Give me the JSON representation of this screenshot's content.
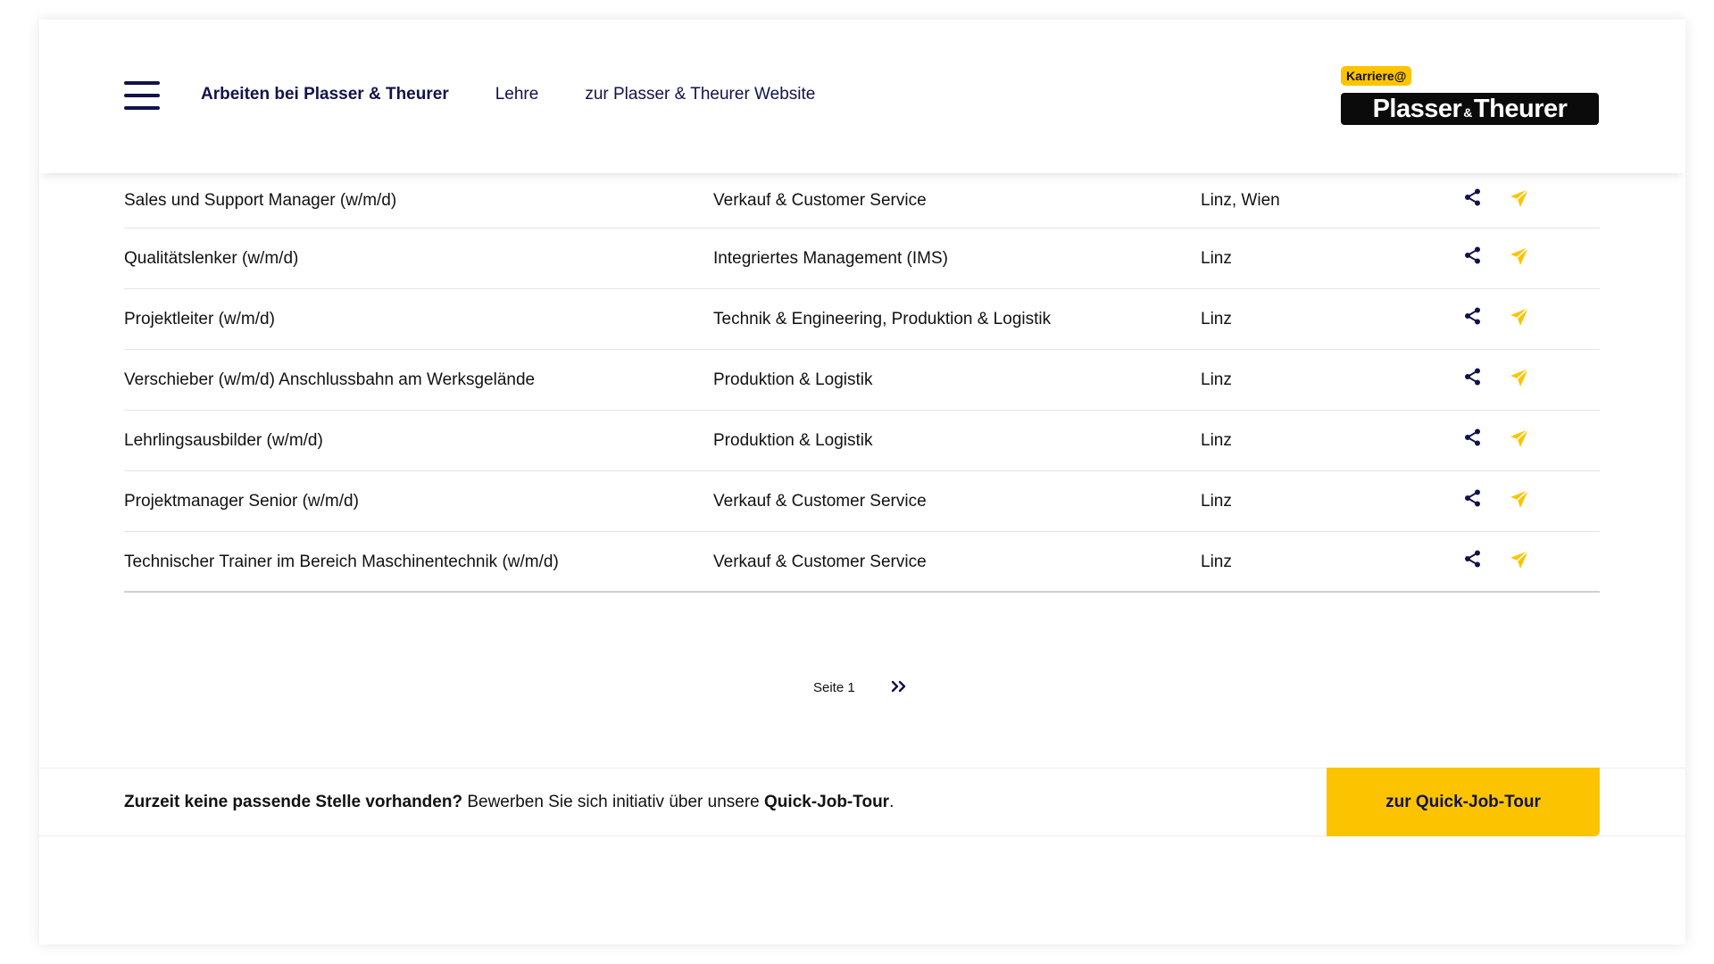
{
  "header": {
    "nav": [
      {
        "label": "Arbeiten bei Plasser & Theurer"
      },
      {
        "label": "Lehre"
      },
      {
        "label": "zur Plasser & Theurer Website"
      }
    ],
    "logo": {
      "badge": "Karriere@",
      "name_left": "Plasser",
      "name_amp": "&",
      "name_right": "Theurer"
    }
  },
  "jobs": [
    {
      "title": "Sales und Support Manager (w/m/d)",
      "category": "Verkauf & Customer Service",
      "location": "Linz, Wien"
    },
    {
      "title": "Qualitätslenker (w/m/d)",
      "category": "Integriertes Management (IMS)",
      "location": "Linz"
    },
    {
      "title": "Projektleiter (w/m/d)",
      "category": "Technik & Engineering, Produktion & Logistik",
      "location": "Linz"
    },
    {
      "title": "Verschieber (w/m/d) Anschlussbahn am Werksgelände",
      "category": "Produktion & Logistik",
      "location": "Linz"
    },
    {
      "title": "Lehrlingsausbilder (w/m/d)",
      "category": "Produktion & Logistik",
      "location": "Linz"
    },
    {
      "title": "Projektmanager Senior (w/m/d)",
      "category": "Verkauf & Customer Service",
      "location": "Linz"
    },
    {
      "title": "Technischer Trainer im Bereich Maschinentechnik (w/m/d)",
      "category": "Verkauf & Customer Service",
      "location": "Linz"
    }
  ],
  "pagination": {
    "page_label": "Seite 1",
    "next_label": "»",
    "next_icon": "double-chevron-right-icon"
  },
  "bottom_bar": {
    "bold_lead": "Zurzeit keine passende Stelle vorhanden?",
    "text": " Bewerben Sie sich initiativ über unsere ",
    "bold_link": "Quick-Job-Tour",
    "end": ".",
    "cta_label": "zur Quick-Job-Tour"
  },
  "icons": {
    "share": "share-icon",
    "send": "paper-plane-icon",
    "menu": "hamburger-menu-icon"
  },
  "colors": {
    "navy": "#12124a",
    "yellow": "#fcc400",
    "black": "#0b0b0b"
  }
}
